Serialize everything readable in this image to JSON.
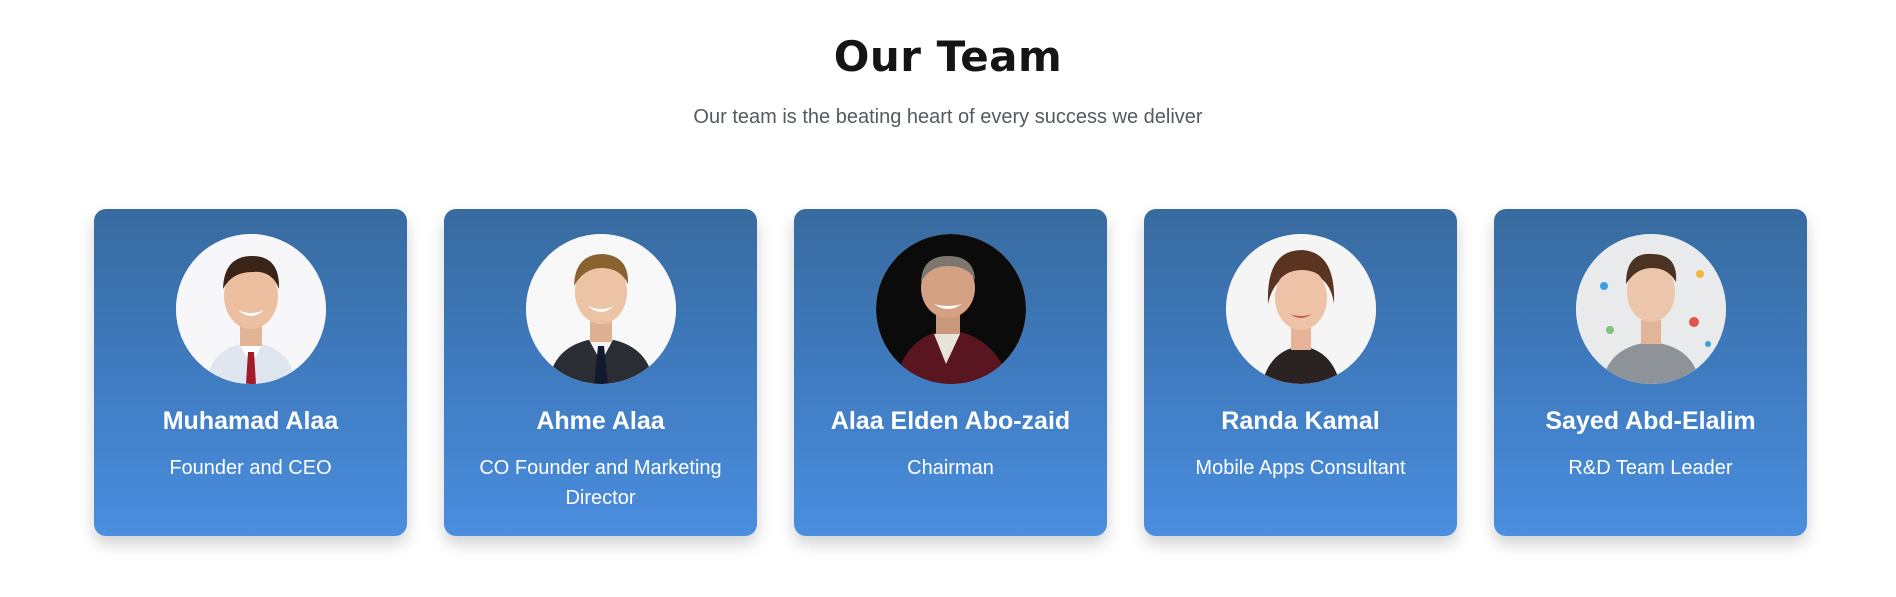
{
  "section": {
    "title": "Our Team",
    "subtitle": "Our team is the beating heart of every success we deliver"
  },
  "team": [
    {
      "name": "Muhamad Alaa",
      "role": "Founder and CEO",
      "avatar_icon": "person-photo"
    },
    {
      "name": "Ahme Alaa",
      "role": "CO Founder and Marketing Director",
      "avatar_icon": "person-photo"
    },
    {
      "name": "Alaa Elden Abo-zaid",
      "role": "Chairman",
      "avatar_icon": "person-photo"
    },
    {
      "name": "Randa Kamal",
      "role": "Mobile Apps Consultant",
      "avatar_icon": "person-photo"
    },
    {
      "name": "Sayed Abd-Elalim",
      "role": "R&D Team Leader",
      "avatar_icon": "person-photo"
    }
  ],
  "colors": {
    "card_top": "#386b9f",
    "card_bottom": "#4a8edf",
    "title": "#151515",
    "subtitle": "#555a60"
  }
}
